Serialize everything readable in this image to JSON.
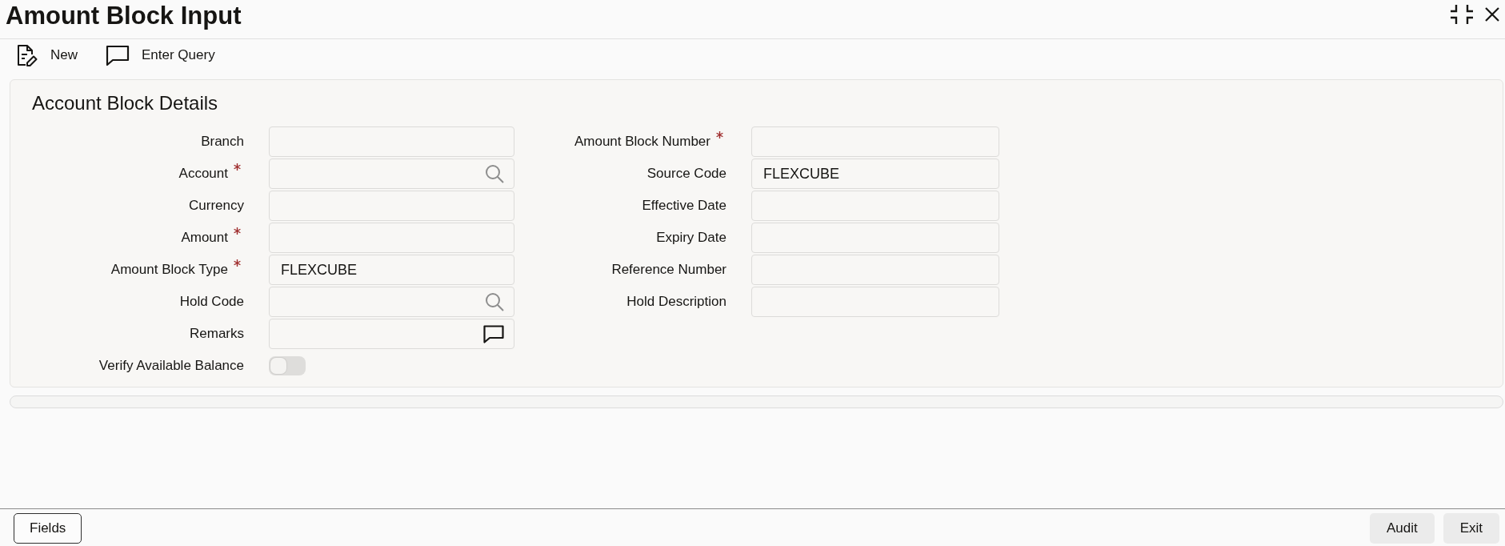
{
  "window": {
    "title": "Amount Block Input"
  },
  "toolbar": [
    {
      "label": "New",
      "kind": "new"
    },
    {
      "label": "Enter Query",
      "kind": "query"
    }
  ],
  "section": {
    "title": "Account Block Details",
    "columns": [
      [
        {
          "label": "Branch",
          "kind": "text",
          "required": false
        },
        {
          "label": "Account",
          "kind": "lookup",
          "required": true
        },
        {
          "label": "Currency",
          "kind": "text",
          "required": false
        },
        {
          "label": "Amount",
          "kind": "text",
          "required": true
        },
        {
          "label": "Amount Block Type",
          "kind": "text",
          "required": true,
          "value": "FLEXCUBE"
        },
        {
          "label": "Hold Code",
          "kind": "lookup",
          "required": false
        },
        {
          "label": "Remarks",
          "kind": "remarks",
          "required": false
        },
        {
          "label": "Verify Available Balance",
          "kind": "toggle",
          "required": false,
          "on": false
        }
      ],
      [
        {
          "label": "Amount Block Number",
          "kind": "text",
          "required": true
        },
        {
          "label": "Source Code",
          "kind": "text",
          "required": false,
          "value": "FLEXCUBE"
        },
        {
          "label": "Effective Date",
          "kind": "text",
          "required": false
        },
        {
          "label": "Expiry Date",
          "kind": "text",
          "required": false
        },
        {
          "label": "Reference Number",
          "kind": "text",
          "required": false
        },
        {
          "label": "Hold Description",
          "kind": "text",
          "required": false
        }
      ]
    ]
  },
  "footer": {
    "left_buttons": [
      {
        "label": "Fields"
      }
    ],
    "right_buttons": [
      {
        "label": "Audit"
      },
      {
        "label": "Exit"
      }
    ]
  }
}
